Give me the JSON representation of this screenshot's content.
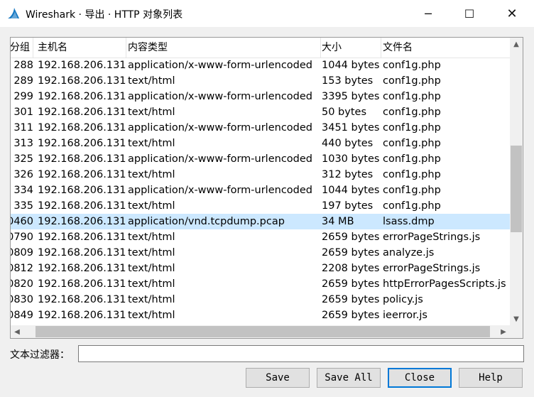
{
  "window": {
    "title": "Wireshark · 导出 · HTTP 对象列表",
    "minimize_glyph": "─",
    "maximize_glyph": "☐",
    "close_glyph": "✕"
  },
  "table": {
    "columns": [
      "分组",
      "主机名",
      "内容类型",
      "大小",
      "文件名"
    ],
    "rows": [
      {
        "packet": "288",
        "host": "192.168.206.131",
        "type": "application/x-www-form-urlencoded",
        "size": "1044 bytes",
        "file": "conf1g.php"
      },
      {
        "packet": "289",
        "host": "192.168.206.131",
        "type": "text/html",
        "size": "153 bytes",
        "file": "conf1g.php"
      },
      {
        "packet": "299",
        "host": "192.168.206.131",
        "type": "application/x-www-form-urlencoded",
        "size": "3395 bytes",
        "file": "conf1g.php"
      },
      {
        "packet": "301",
        "host": "192.168.206.131",
        "type": "text/html",
        "size": "50 bytes",
        "file": "conf1g.php"
      },
      {
        "packet": "311",
        "host": "192.168.206.131",
        "type": "application/x-www-form-urlencoded",
        "size": "3451 bytes",
        "file": "conf1g.php"
      },
      {
        "packet": "313",
        "host": "192.168.206.131",
        "type": "text/html",
        "size": "440 bytes",
        "file": "conf1g.php"
      },
      {
        "packet": "325",
        "host": "192.168.206.131",
        "type": "application/x-www-form-urlencoded",
        "size": "1030 bytes",
        "file": "conf1g.php"
      },
      {
        "packet": "326",
        "host": "192.168.206.131",
        "type": "text/html",
        "size": "312 bytes",
        "file": "conf1g.php"
      },
      {
        "packet": "334",
        "host": "192.168.206.131",
        "type": "application/x-www-form-urlencoded",
        "size": "1044 bytes",
        "file": "conf1g.php"
      },
      {
        "packet": "335",
        "host": "192.168.206.131",
        "type": "text/html",
        "size": "197 bytes",
        "file": "conf1g.php"
      },
      {
        "packet": "0460",
        "host": "192.168.206.131",
        "type": "application/vnd.tcpdump.pcap",
        "size": "34 MB",
        "file": "lsass.dmp",
        "selected": true
      },
      {
        "packet": "0790",
        "host": "192.168.206.131",
        "type": "text/html",
        "size": "2659 bytes",
        "file": "errorPageStrings.js"
      },
      {
        "packet": "0809",
        "host": "192.168.206.131",
        "type": "text/html",
        "size": "2659 bytes",
        "file": "analyze.js"
      },
      {
        "packet": "0812",
        "host": "192.168.206.131",
        "type": "text/html",
        "size": "2208 bytes",
        "file": "errorPageStrings.js"
      },
      {
        "packet": "0820",
        "host": "192.168.206.131",
        "type": "text/html",
        "size": "2659 bytes",
        "file": "httpErrorPagesScripts.js"
      },
      {
        "packet": "0830",
        "host": "192.168.206.131",
        "type": "text/html",
        "size": "2659 bytes",
        "file": "policy.js"
      },
      {
        "packet": "0849",
        "host": "192.168.206.131",
        "type": "text/html",
        "size": "2659 bytes",
        "file": "ieerror.js"
      }
    ]
  },
  "filter": {
    "label": "文本过滤器：",
    "value": ""
  },
  "buttons": {
    "save": "Save",
    "save_all": "Save All",
    "close": "Close",
    "help": "Help"
  },
  "colors": {
    "selected_row": "#cce8ff",
    "primary_border": "#0078d7"
  }
}
